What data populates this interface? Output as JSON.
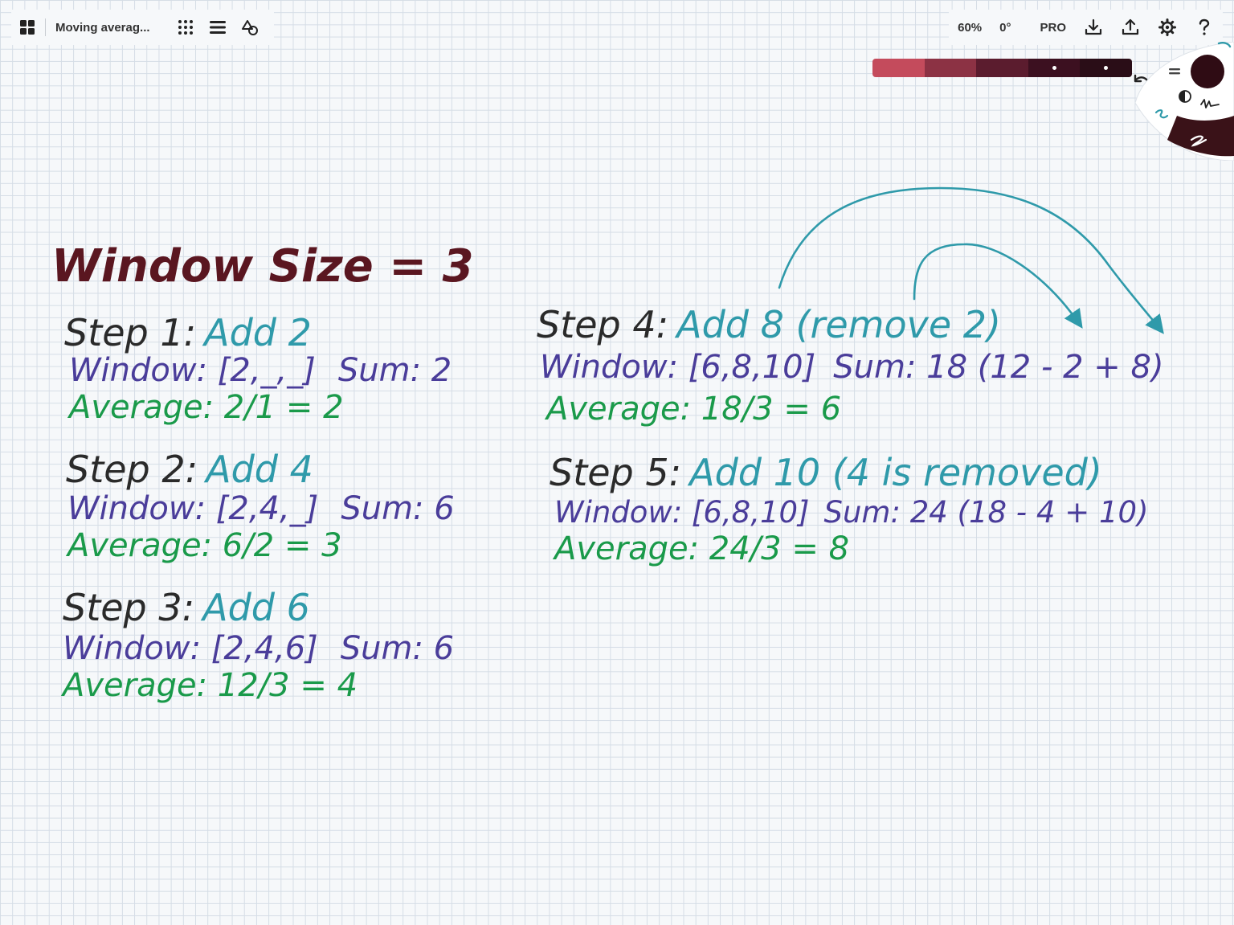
{
  "toolbar": {
    "document_title": "Moving averag...",
    "zoom": "60%",
    "rotation": "0°",
    "pro_label": "PRO",
    "icons": [
      "grid-menu-icon",
      "dot-grid-icon",
      "layers-icon",
      "shapes-icon",
      "download-icon",
      "share-icon",
      "settings-icon",
      "help-icon"
    ]
  },
  "palette": {
    "swatches": [
      "#c44b5c",
      "#8c3244",
      "#5b1c2e",
      "#3c1020",
      "#2a0d17"
    ],
    "selected": [
      "#3c1020",
      "#2a0d17"
    ],
    "current_color": "#2f0c14",
    "accent_teal": "#2f9aaa"
  },
  "notes": {
    "title": "Window Size = 3",
    "steps": [
      {
        "header": "Step 1:",
        "action": "Add 2",
        "window": "Window: [2,_,_]",
        "sum": "Sum: 2",
        "average": "Average: 2/1 = 2"
      },
      {
        "header": "Step 2:",
        "action": "Add 4",
        "window": "Window: [2,4,_]",
        "sum": "Sum: 6",
        "average": "Average: 6/2 = 3"
      },
      {
        "header": "Step 3:",
        "action": "Add 6",
        "window": "Window: [2,4,6]",
        "sum": "Sum: 6",
        "average": "Average: 12/3 = 4"
      },
      {
        "header": "Step 4:",
        "action": "Add 8 (remove 2)",
        "window": "Window: [6,8,10]",
        "sum": "Sum: 18 (12 - 2 + 8)",
        "average": "Average: 18/3 = 6"
      },
      {
        "header": "Step 5:",
        "action": "Add 10 (4 is removed)",
        "window": "Window: [6,8,10]",
        "sum": "Sum: 24 (18 - 4 + 10)",
        "average": "Average: 24/3 = 8"
      }
    ],
    "colors": {
      "title": "#5a1620",
      "header": "#2a2a2a",
      "action": "#2f9aaa",
      "window": "#4a3d9a",
      "average": "#1a9a4a",
      "arrow": "#2f9aaa"
    }
  }
}
